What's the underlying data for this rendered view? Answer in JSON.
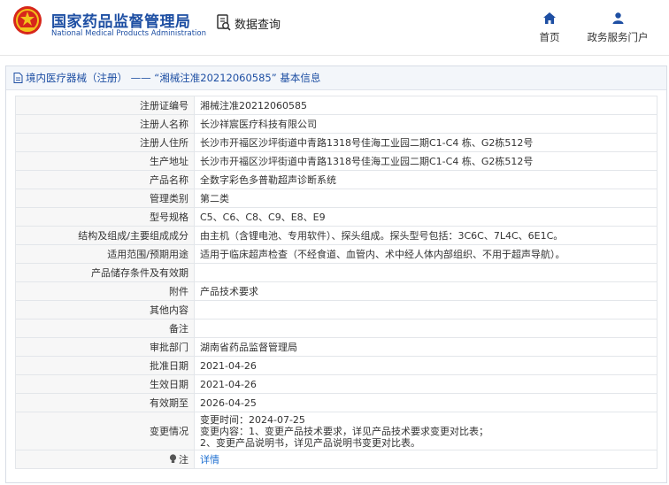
{
  "header": {
    "site_name": "国家药品监督管理局",
    "site_name_en": "National Medical Products Administration",
    "search_label": "数据查询",
    "nav": [
      {
        "label": "首页",
        "icon": "home-icon"
      },
      {
        "label": "政务服务门户",
        "icon": "user-icon"
      }
    ]
  },
  "panel": {
    "title": "境内医疗器械（注册） —— “湘械注准20212060585” 基本信息"
  },
  "rows": [
    {
      "label": "注册证编号",
      "value": "湘械注准20212060585"
    },
    {
      "label": "注册人名称",
      "value": "长沙祥宸医疗科技有限公司"
    },
    {
      "label": "注册人住所",
      "value": "长沙市开福区沙坪街道中青路1318号佳海工业园二期C1-C4 栋、G2栋512号"
    },
    {
      "label": "生产地址",
      "value": "长沙市开福区沙坪街道中青路1318号佳海工业园二期C1-C4 栋、G2栋512号"
    },
    {
      "label": "产品名称",
      "value": "全数字彩色多普勒超声诊断系统"
    },
    {
      "label": "管理类别",
      "value": "第二类"
    },
    {
      "label": "型号规格",
      "value": "C5、C6、C8、C9、E8、E9"
    },
    {
      "label": "结构及组成/主要组成成分",
      "value": "由主机（含锂电池、专用软件）、探头组成。探头型号包括：3C6C、7L4C、6E1C。"
    },
    {
      "label": "适用范围/预期用途",
      "value": "适用于临床超声检查（不经食道、血管内、术中经人体内部组织、不用于超声导航）。"
    },
    {
      "label": "产品储存条件及有效期",
      "value": ""
    },
    {
      "label": "附件",
      "value": "产品技术要求"
    },
    {
      "label": "其他内容",
      "value": ""
    },
    {
      "label": "备注",
      "value": ""
    },
    {
      "label": "审批部门",
      "value": "湖南省药品监督管理局"
    },
    {
      "label": "批准日期",
      "value": "2021-04-26"
    },
    {
      "label": "生效日期",
      "value": "2021-04-26"
    },
    {
      "label": "有效期至",
      "value": "2026-04-25"
    }
  ],
  "change": {
    "label": "变更情况",
    "lines": [
      "变更时间：2024-07-25",
      "变更内容：1、变更产品技术要求，详见产品技术要求变更对比表；",
      "2、变更产品说明书，详见产品说明书变更对比表。"
    ]
  },
  "note": {
    "label": "注",
    "link": "详情",
    "icon": "bulb-icon"
  },
  "colors": {
    "brand": "#1e4fa3",
    "link": "#1e6fd1",
    "emblem_red": "#d7261b",
    "emblem_gold": "#f2c21b"
  }
}
